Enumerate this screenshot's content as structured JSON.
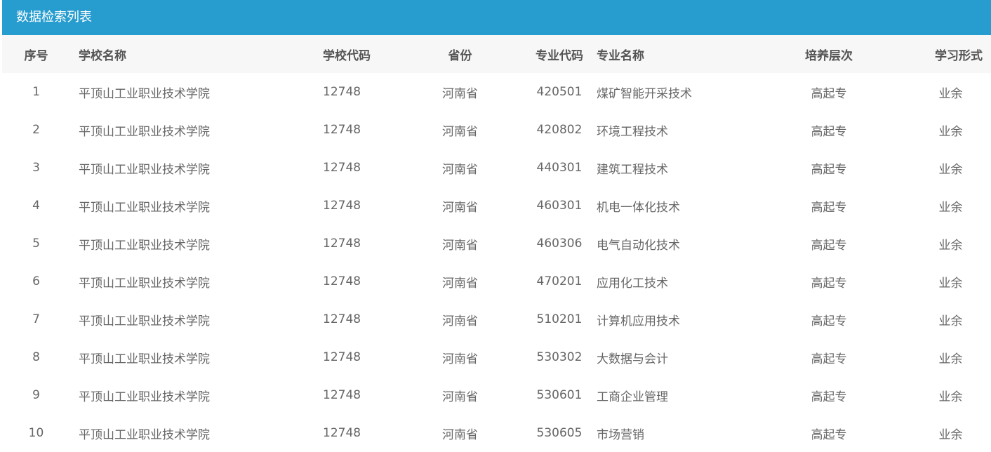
{
  "panel": {
    "title": "数据检索列表"
  },
  "table": {
    "headers": {
      "idx": "序号",
      "school_name": "学校名称",
      "school_code": "学校代码",
      "province": "省份",
      "major_code": "专业代码",
      "major_name": "专业名称",
      "level": "培养层次",
      "study_mode": "学习形式"
    },
    "rows": [
      {
        "idx": "1",
        "school_name": "平顶山工业职业技术学院",
        "school_code": "12748",
        "province": "河南省",
        "major_code": "420501",
        "major_name": "煤矿智能开采技术",
        "level": "高起专",
        "study_mode": "业余"
      },
      {
        "idx": "2",
        "school_name": "平顶山工业职业技术学院",
        "school_code": "12748",
        "province": "河南省",
        "major_code": "420802",
        "major_name": "环境工程技术",
        "level": "高起专",
        "study_mode": "业余"
      },
      {
        "idx": "3",
        "school_name": "平顶山工业职业技术学院",
        "school_code": "12748",
        "province": "河南省",
        "major_code": "440301",
        "major_name": "建筑工程技术",
        "level": "高起专",
        "study_mode": "业余"
      },
      {
        "idx": "4",
        "school_name": "平顶山工业职业技术学院",
        "school_code": "12748",
        "province": "河南省",
        "major_code": "460301",
        "major_name": "机电一体化技术",
        "level": "高起专",
        "study_mode": "业余"
      },
      {
        "idx": "5",
        "school_name": "平顶山工业职业技术学院",
        "school_code": "12748",
        "province": "河南省",
        "major_code": "460306",
        "major_name": "电气自动化技术",
        "level": "高起专",
        "study_mode": "业余"
      },
      {
        "idx": "6",
        "school_name": "平顶山工业职业技术学院",
        "school_code": "12748",
        "province": "河南省",
        "major_code": "470201",
        "major_name": "应用化工技术",
        "level": "高起专",
        "study_mode": "业余"
      },
      {
        "idx": "7",
        "school_name": "平顶山工业职业技术学院",
        "school_code": "12748",
        "province": "河南省",
        "major_code": "510201",
        "major_name": "计算机应用技术",
        "level": "高起专",
        "study_mode": "业余"
      },
      {
        "idx": "8",
        "school_name": "平顶山工业职业技术学院",
        "school_code": "12748",
        "province": "河南省",
        "major_code": "530302",
        "major_name": "大数据与会计",
        "level": "高起专",
        "study_mode": "业余"
      },
      {
        "idx": "9",
        "school_name": "平顶山工业职业技术学院",
        "school_code": "12748",
        "province": "河南省",
        "major_code": "530601",
        "major_name": "工商企业管理",
        "level": "高起专",
        "study_mode": "业余"
      },
      {
        "idx": "10",
        "school_name": "平顶山工业职业技术学院",
        "school_code": "12748",
        "province": "河南省",
        "major_code": "530605",
        "major_name": "市场营销",
        "level": "高起专",
        "study_mode": "业余"
      }
    ]
  },
  "colors": {
    "header_bar": "#279ccf",
    "table_head_bg": "#f7f7f7",
    "header_text": "#555555",
    "cell_text": "#666666"
  }
}
